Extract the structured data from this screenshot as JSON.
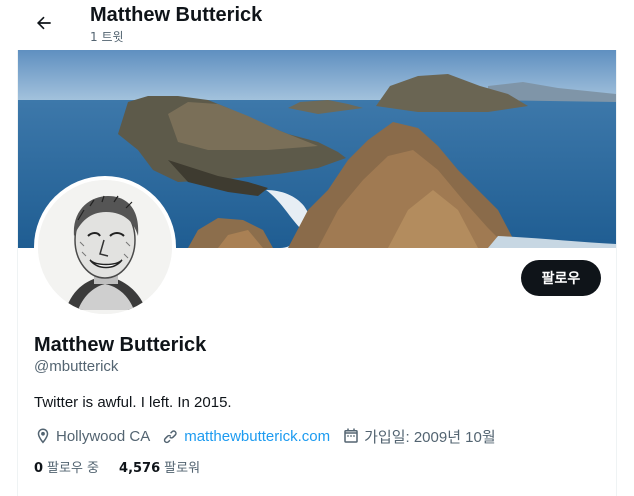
{
  "header": {
    "title": "Matthew Butterick",
    "tweet_count": "1 트윗"
  },
  "profile": {
    "display_name": "Matthew Butterick",
    "handle": "@mbutterick",
    "bio": "Twitter is awful. I left. In 2015.",
    "location": "Hollywood CA",
    "website": "matthewbutterick.com",
    "joined": "가입일: 2009년 10월",
    "following_count": "0",
    "following_label": "팔로우 중",
    "followers_count": "4,576",
    "followers_label": "팔로워",
    "follow_button": "팔로우"
  },
  "icons": {
    "back": "arrow-left-icon",
    "location": "map-pin-icon",
    "link": "link-icon",
    "calendar": "calendar-icon"
  },
  "colors": {
    "accent": "#1d9bf0",
    "text": "#0f1419",
    "muted": "#536471",
    "button_bg": "#0f1419"
  }
}
